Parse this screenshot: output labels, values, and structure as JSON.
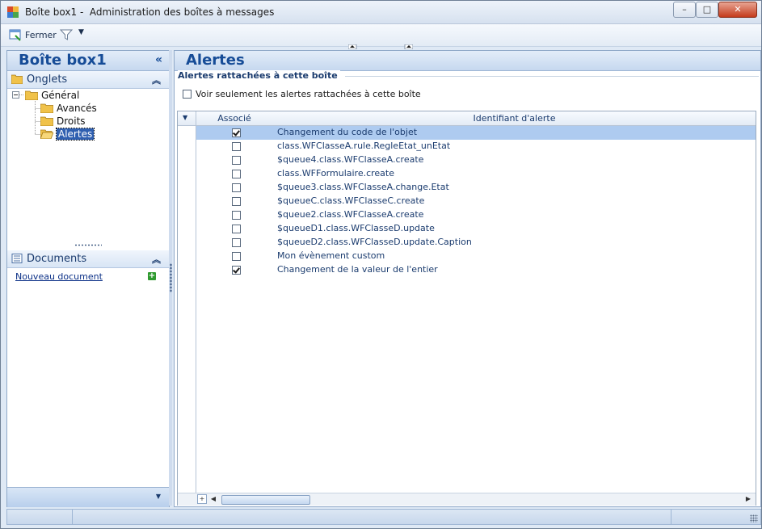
{
  "window": {
    "title": "Boîte box1 -  Administration des boîtes à messages",
    "controls": {
      "minimize": "–",
      "maximize": "□",
      "close": "✕"
    }
  },
  "toolbar": {
    "close_label": "Fermer"
  },
  "left_panel": {
    "title": "Boîte box1",
    "collapse_glyph": "«",
    "tabs_section": {
      "label": "Onglets",
      "tree": {
        "root": "Général",
        "children": [
          "Avancés",
          "Droits",
          "Alertes"
        ],
        "selected": "Alertes"
      }
    },
    "documents_section": {
      "label": "Documents",
      "new_document_link": "Nouveau document"
    }
  },
  "main_panel": {
    "title": "Alertes",
    "group_title": "Alertes rattachées à cette boîte",
    "filter_label": "Voir seulement les alertes rattachées à cette boîte",
    "filter_checked": false,
    "grid": {
      "columns": [
        "Associé",
        "Identifiant d'alerte"
      ],
      "rows": [
        {
          "associated": true,
          "id": "Changement du code de l'objet",
          "selected": true
        },
        {
          "associated": false,
          "id": "class.WFClasseA.rule.RegleEtat_unEtat"
        },
        {
          "associated": false,
          "id": "$queue4.class.WFClasseA.create"
        },
        {
          "associated": false,
          "id": "class.WFFormulaire.create"
        },
        {
          "associated": false,
          "id": "$queue3.class.WFClasseA.change.Etat"
        },
        {
          "associated": false,
          "id": "$queueC.class.WFClasseC.create"
        },
        {
          "associated": false,
          "id": "$queue2.class.WFClasseA.create"
        },
        {
          "associated": false,
          "id": "$queueD1.class.WFClasseD.update"
        },
        {
          "associated": false,
          "id": "$queueD2.class.WFClasseD.update.Caption"
        },
        {
          "associated": false,
          "id": "Mon évènement custom"
        },
        {
          "associated": true,
          "id": "Changement de la valeur de l'entier"
        }
      ]
    }
  },
  "colors": {
    "accent": "#164c97",
    "selection": "#aecbf0",
    "tree_selection": "#2f5fb0"
  }
}
